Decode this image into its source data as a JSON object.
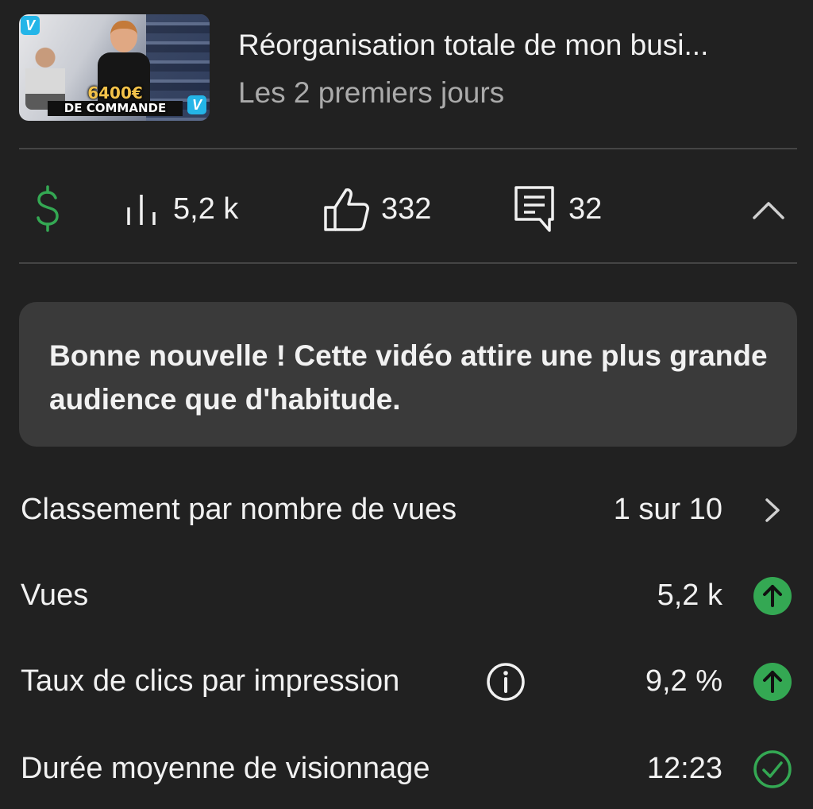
{
  "video": {
    "thumbnail_caption_amount": "6400€",
    "thumbnail_caption_label": "DE COMMANDE",
    "thumbnail_badge": "V",
    "title": "Réorganisation totale de mon busi...",
    "period": "Les 2 premiers jours"
  },
  "metrics": {
    "views": "5,2 k",
    "likes": "332",
    "comments": "32"
  },
  "notice": {
    "text": "Bonne nouvelle ! Cette vidéo attire une plus grande audience que d'habitude."
  },
  "stats": [
    {
      "label": "Classement par nombre de vues",
      "value": "1 sur 10",
      "icon": "chevron-right-icon"
    },
    {
      "label": "Vues",
      "value": "5,2 k",
      "icon": "arrow-up-circle-icon"
    },
    {
      "label": "Taux de clics par impression",
      "value": "9,2 %",
      "icon": "arrow-up-circle-icon"
    },
    {
      "label": "Durée moyenne de visionnage",
      "value": "12:23",
      "icon": "check-circle-icon"
    }
  ],
  "colors": {
    "background": "#212121",
    "card": "#3a3a3a",
    "divider": "#454545",
    "accent_green": "#34a853",
    "secondary_text": "#aaaaaa"
  }
}
